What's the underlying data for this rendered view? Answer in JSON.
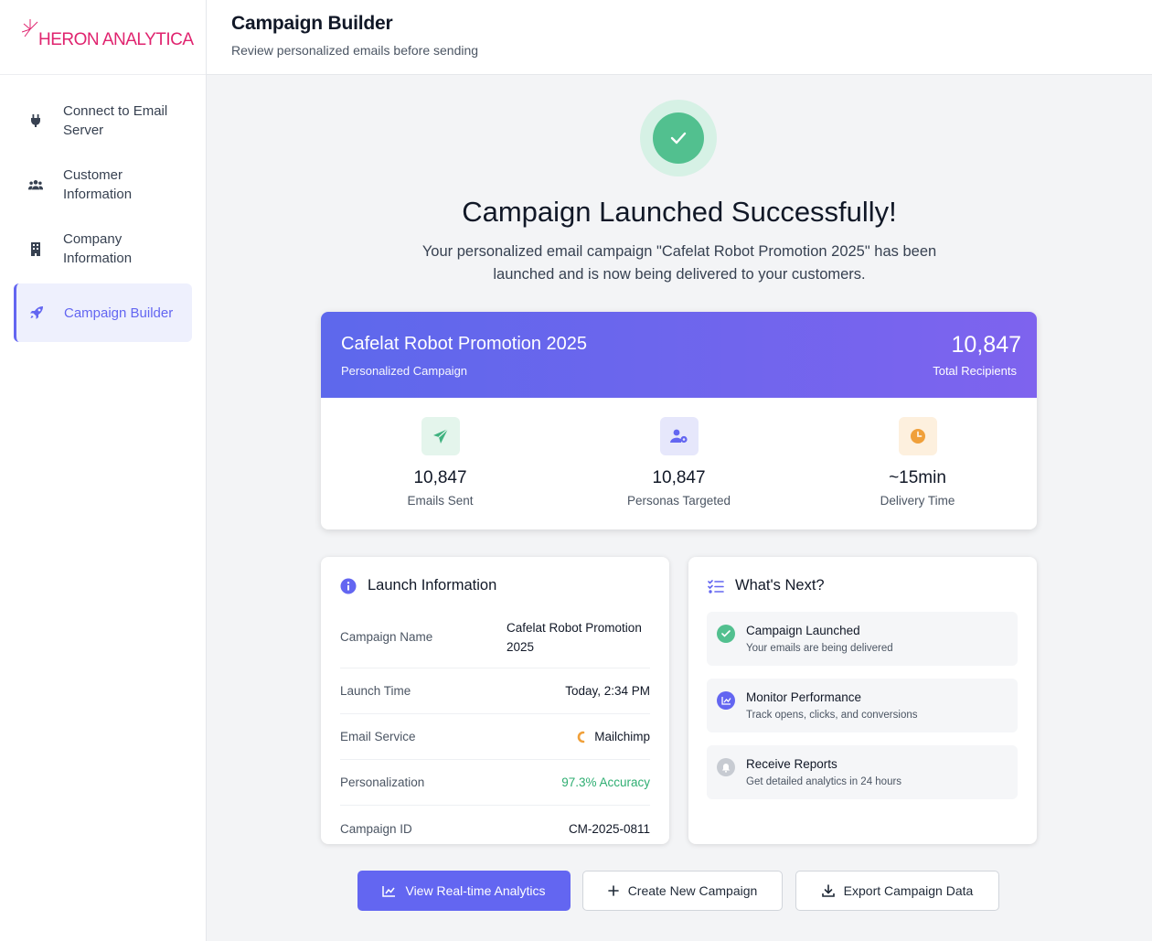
{
  "brand": {
    "name": "HERON ANALYTICA",
    "color": "#e0246f"
  },
  "sidebar": {
    "items": [
      {
        "label": "Connect to Email Server",
        "icon": "plug-icon",
        "active": false
      },
      {
        "label": "Customer Information",
        "icon": "users-icon",
        "active": false
      },
      {
        "label": "Company Information",
        "icon": "building-icon",
        "active": false
      },
      {
        "label": "Campaign Builder",
        "icon": "rocket-icon",
        "active": true
      }
    ]
  },
  "header": {
    "title": "Campaign Builder",
    "subtitle": "Review personalized emails before sending"
  },
  "hero": {
    "title": "Campaign Launched Successfully!",
    "message": "Your personalized email campaign \"Cafelat Robot Promotion 2025\" has been launched and is now being delivered to your customers."
  },
  "summary": {
    "campaign_name": "Cafelat Robot Promotion 2025",
    "campaign_type": "Personalized Campaign",
    "total_recipients": "10,847",
    "total_label": "Total Recipients",
    "stats": [
      {
        "value": "10,847",
        "label": "Emails Sent",
        "icon": "paper-plane-icon",
        "color": "#3fb27f"
      },
      {
        "value": "10,847",
        "label": "Personas Targeted",
        "icon": "user-target-icon",
        "color": "#6366f1"
      },
      {
        "value": "~15min",
        "label": "Delivery Time",
        "icon": "clock-icon",
        "color": "#f0a03a"
      }
    ]
  },
  "launch_info": {
    "title": "Launch Information",
    "rows": [
      {
        "label": "Campaign Name",
        "value": "Cafelat Robot Promotion 2025"
      },
      {
        "label": "Launch Time",
        "value": "Today, 2:34 PM"
      },
      {
        "label": "Email Service",
        "value": "Mailchimp"
      },
      {
        "label": "Personalization",
        "value": "97.3% Accuracy"
      },
      {
        "label": "Campaign ID",
        "value": "CM-2025-0811"
      }
    ]
  },
  "next_steps": {
    "title": "What's Next?",
    "steps": [
      {
        "title": "Campaign Launched",
        "desc": "Your emails are being delivered",
        "icon": "check-circle-icon",
        "color": "#52c08f"
      },
      {
        "title": "Monitor Performance",
        "desc": "Track opens, clicks, and conversions",
        "icon": "chart-line-icon",
        "color": "#6366f1"
      },
      {
        "title": "Receive Reports",
        "desc": "Get detailed analytics in 24 hours",
        "icon": "bell-icon",
        "color": "#c7cbd2"
      }
    ]
  },
  "actions": {
    "analytics": "View Real-time Analytics",
    "create": "Create New Campaign",
    "export": "Export Campaign Data"
  },
  "colors": {
    "accent": "#6366f1",
    "success": "#52c08f"
  }
}
